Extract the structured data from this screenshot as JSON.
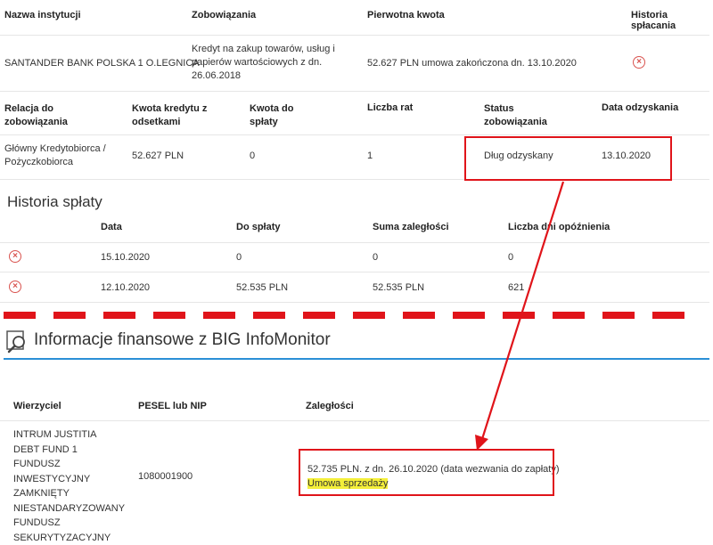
{
  "table1": {
    "headers": {
      "institution": "Nazwa instytucji",
      "obligations": "Zobowiązania",
      "original_amount": "Pierwotna kwota",
      "repayment_history": "Historia spłacania"
    },
    "row": {
      "institution": "SANTANDER BANK POLSKA 1 O.LEGNICA",
      "obligation": "Kredyt na zakup towarów, usług i papierów wartościowych z dn. 26.06.2018",
      "original_amount": "52.627 PLN umowa zakończona dn. 13.10.2020"
    }
  },
  "table2": {
    "headers": {
      "relation": "Relacja do zobowiązania",
      "credit_amount": "Kwota kredytu z odsetkami",
      "to_pay": "Kwota do spłaty",
      "installments": "Liczba rat",
      "status": "Status zobowiązania",
      "recovery_date": "Data odzyskania"
    },
    "row": {
      "relation": "Główny Kredytobiorca / Pożyczkobiorca",
      "credit_amount": "52.627 PLN",
      "to_pay": "0",
      "installments": "1",
      "status": "Dług odzyskany",
      "recovery_date": "13.10.2020"
    }
  },
  "history": {
    "title": "Historia spłaty",
    "headers": {
      "date": "Data",
      "to_pay": "Do spłaty",
      "arrears": "Suma zaległości",
      "days_late": "Liczba dni opóźnienia"
    },
    "rows": [
      {
        "date": "15.10.2020",
        "to_pay": "0",
        "arrears": "0",
        "days_late": "0"
      },
      {
        "date": "12.10.2020",
        "to_pay": "52.535 PLN",
        "arrears": "52.535 PLN",
        "days_late": "621"
      }
    ]
  },
  "big": {
    "title": "Informacje finansowe z BIG InfoMonitor",
    "headers": {
      "creditor": "Wierzyciel",
      "pesel": "PESEL lub NIP",
      "arrears": "Zaległości"
    },
    "row": {
      "creditor": "INTRUM JUSTITIA DEBT FUND 1 FUNDUSZ INWESTYCYJNY ZAMKNIĘTY NIESTANDARYZOWANY FUNDUSZ SEKURYTYZACYJNY",
      "pesel": "1080001900",
      "arrears": "52.735 PLN. z dn. 26.10.2020 (data wezwania do zapłaty)",
      "note": "Umowa sprzedaży"
    }
  },
  "colors": {
    "annotation_red": "#e0141a",
    "status_icon_red": "#d9534f",
    "accent_blue": "#2a8fd6",
    "highlight_yellow": "#f4ef3a"
  },
  "icons": {
    "status": "x-circle-icon",
    "big_search": "search-icon"
  }
}
